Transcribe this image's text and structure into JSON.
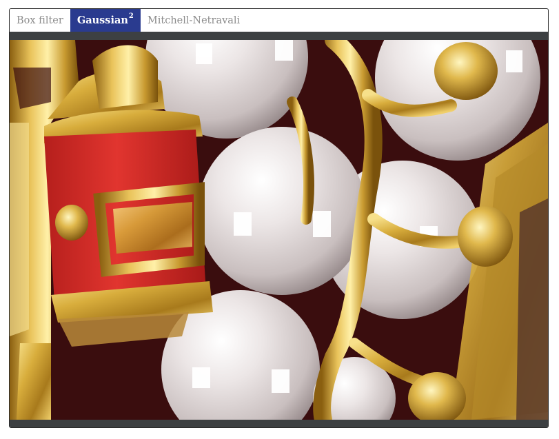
{
  "tabs": [
    {
      "label": "Box filter",
      "active": false
    },
    {
      "label": "Gaussian",
      "superscript": "2",
      "active": true
    },
    {
      "label": "Mitchell-Netravali",
      "active": false
    }
  ],
  "viewer": {
    "image_subject": "rendered gold ornament with pearls and red enamel band"
  },
  "colors": {
    "active_tab": "#2a3b8f",
    "toolbar": "#3d4042",
    "gold": "#d4a93a",
    "pearl": "#e9e2e2",
    "red_enamel": "#d9302b",
    "background": "#3a0d0e"
  }
}
